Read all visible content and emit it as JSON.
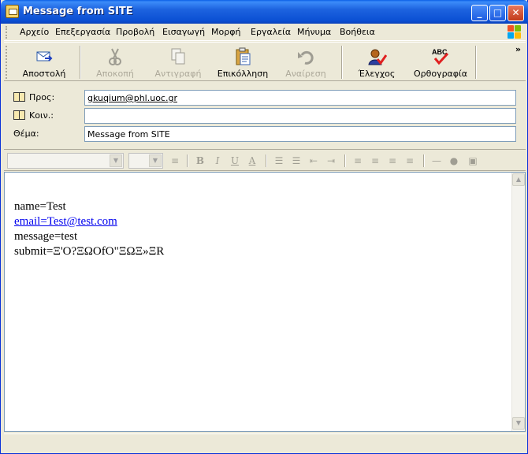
{
  "window": {
    "title": "Message from SITE",
    "controls": {
      "minimize": "_",
      "maximize": "□",
      "close": "✕"
    }
  },
  "menu": {
    "items": [
      "Αρχείο",
      "Επεξεργασία",
      "Προβολή",
      "Εισαγωγή",
      "Μορφή",
      "Εργαλεία",
      "Μήνυμα",
      "Βοήθεια"
    ]
  },
  "toolbar": {
    "send": "Αποστολή",
    "cut": "Αποκοπή",
    "copy": "Αντιγραφή",
    "paste": "Επικόλληση",
    "undo": "Αναίρεση",
    "check": "Έλεγχος",
    "spelling": "Ορθογραφία",
    "spelling_icon_text": "ABC",
    "more": "»"
  },
  "header": {
    "to_label": "Προς:",
    "to_value": "gkuqium@phl.uoc.gr",
    "cc_label": "Κοιν.:",
    "cc_value": "",
    "subject_label": "Θέμα:",
    "subject_value": "Message from SITE"
  },
  "format_toolbar": {
    "font_name": "",
    "font_size": "",
    "bold": "B",
    "italic": "I",
    "underline": "U",
    "color": "A"
  },
  "body": {
    "line1": "name=Test",
    "line2": "email=Test@test.com",
    "line3": "message=test",
    "line4": "submit=Ξ'Ο?ΞΩΟfΟ\"ΞΩΞ»ΞR"
  },
  "colors": {
    "titlebar": "#0b4fd3",
    "chrome": "#ece9d8",
    "link": "#0000ee",
    "field_border": "#7f9db9"
  }
}
